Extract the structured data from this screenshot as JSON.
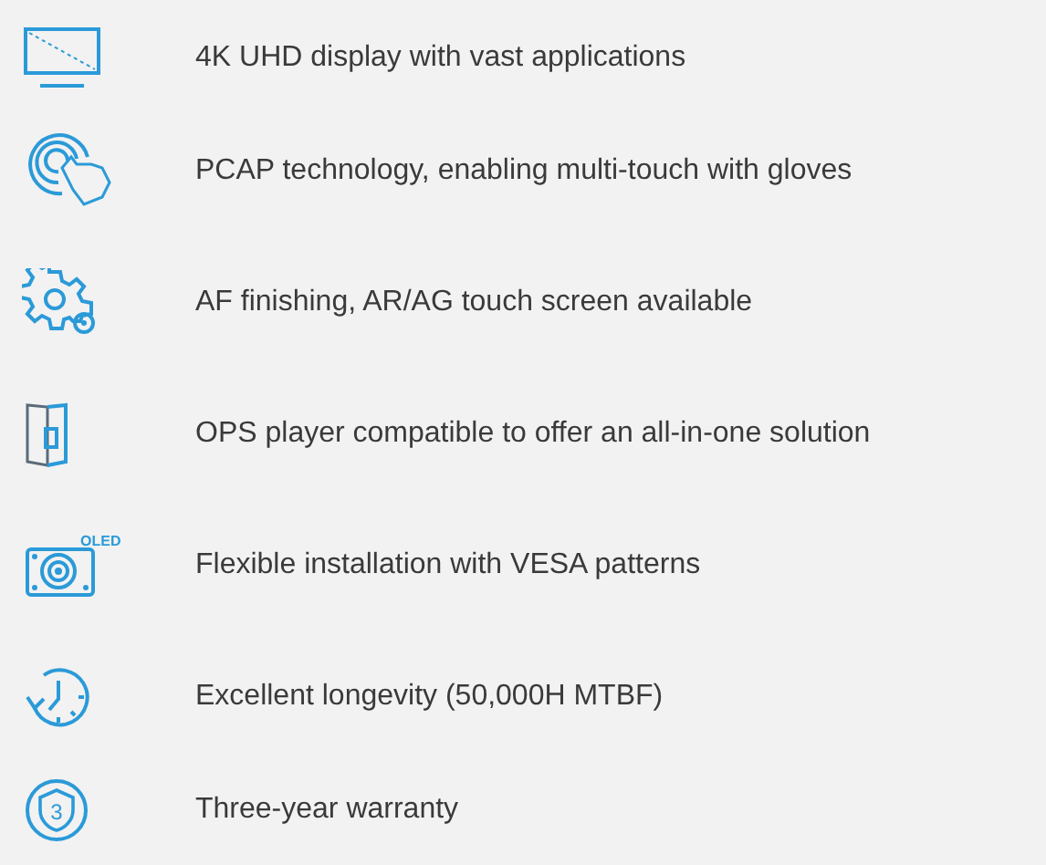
{
  "features": [
    {
      "kind": "monitor",
      "text": "4K UHD display with vast applications"
    },
    {
      "kind": "touch",
      "text": "PCAP technology, enabling multi-touch with gloves"
    },
    {
      "kind": "gear",
      "text": "AF finishing, AR/AG touch screen available"
    },
    {
      "kind": "player",
      "text": "OPS player compatible to offer an all-in-one solution"
    },
    {
      "kind": "mount",
      "text": "Flexible installation with VESA patterns",
      "icon_text": "OLED"
    },
    {
      "kind": "clock",
      "text": "Excellent longevity (50,000H MTBF)"
    },
    {
      "kind": "shield",
      "text": "Three-year warranty",
      "icon_text": "3"
    }
  ]
}
